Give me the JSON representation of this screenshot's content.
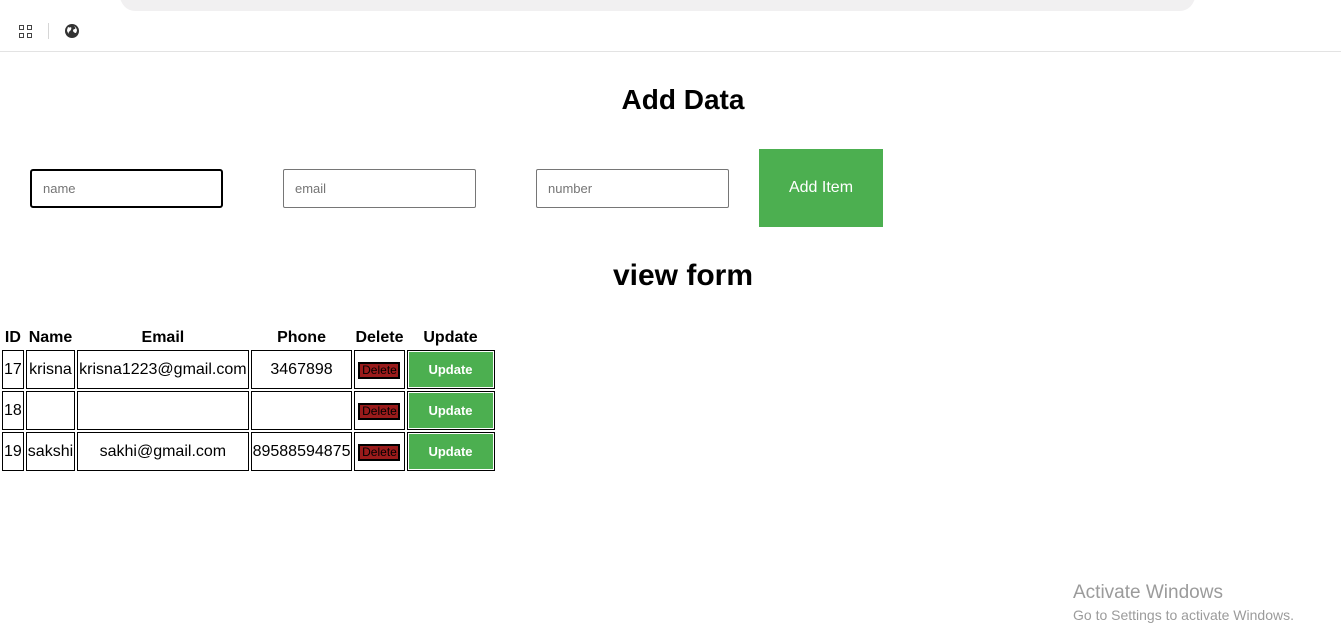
{
  "form": {
    "title": "Add Data",
    "name_placeholder": "name",
    "email_placeholder": "email",
    "number_placeholder": "number",
    "add_label": "Add Item"
  },
  "view": {
    "title": "view form",
    "columns": [
      "ID",
      "Name",
      "Email",
      "Phone",
      "Delete",
      "Update"
    ],
    "rows": [
      {
        "id": "17",
        "name": "krisna",
        "email": "krisna1223@gmail.com",
        "phone": "3467898",
        "delete_label": "Delete",
        "update_label": "Update"
      },
      {
        "id": "18",
        "name": "",
        "email": "",
        "phone": "",
        "delete_label": "Delete",
        "update_label": "Update"
      },
      {
        "id": "19",
        "name": "sakshi",
        "email": "sakhi@gmail.com",
        "phone": "89588594875",
        "delete_label": "Delete",
        "update_label": "Update"
      }
    ]
  },
  "watermark": {
    "title": "Activate Windows",
    "subtitle": "Go to Settings to activate Windows."
  },
  "colors": {
    "accent_green": "#4caf50",
    "delete_red": "#9a1b1b"
  }
}
